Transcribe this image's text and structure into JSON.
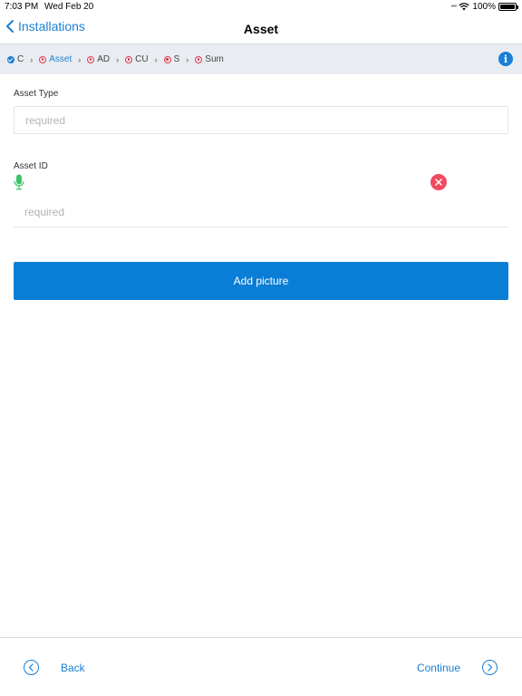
{
  "status_bar": {
    "time": "7:03 PM",
    "date": "Wed Feb 20",
    "battery": "100%"
  },
  "nav": {
    "back_label": "Installations",
    "title": "Asset"
  },
  "breadcrumb": {
    "items": [
      {
        "label": "C",
        "state": "done"
      },
      {
        "label": "Asset",
        "state": "current"
      },
      {
        "label": "AD",
        "state": "pending"
      },
      {
        "label": "CU",
        "state": "pending"
      },
      {
        "label": "S",
        "state": "pending"
      },
      {
        "label": "Sum",
        "state": "pending"
      }
    ],
    "info_icon": "i"
  },
  "form": {
    "asset_type_label": "Asset Type",
    "asset_type_placeholder": "required",
    "asset_type_value": "",
    "asset_id_label": "Asset ID",
    "asset_id_placeholder": "required",
    "asset_id_value": "",
    "add_picture_label": "Add picture"
  },
  "footer": {
    "back_label": "Back",
    "continue_label": "Continue"
  },
  "colors": {
    "accent": "#1a7fd6",
    "primary_button": "#0a7dd6",
    "error": "#f04a5e",
    "mic": "#3cc46a"
  }
}
